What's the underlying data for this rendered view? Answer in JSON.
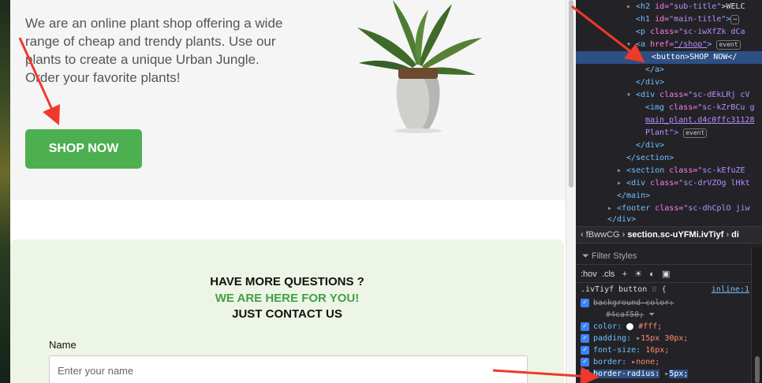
{
  "page": {
    "hero_text": "We are an online plant shop offering a wide range of cheap and trendy plants. Use our plants to create a unique Urban Jungle. Order your favorite plants!",
    "shop_button": "SHOP NOW",
    "contact": {
      "line1": "HAVE MORE QUESTIONS ?",
      "line2": "WE ARE HERE FOR YOU!",
      "line3": "JUST CONTACT US",
      "name_label": "Name",
      "name_placeholder": "Enter your name"
    }
  },
  "devtools": {
    "dom": {
      "l1_tag": "<h2 ",
      "l1_attr": "id=",
      "l1_val": "\"sub-title\"",
      "l1_txt": ">WELC",
      "l2_tag": "<h1 ",
      "l2_attr": "id=",
      "l2_val": "\"main-title\"",
      "l2_txt": ">",
      "l3_tag": "<p ",
      "l3_attr": "class=",
      "l3_val": "\"sc-iwXfZk dCa",
      "l4_tag": "<a ",
      "l4_attr": "href=",
      "l4_val": "\"/shop\"",
      "l4_end": ">",
      "badge_event": "event",
      "l5": "<button>SHOP NOW</",
      "l6": "</a>",
      "l7": "</div>",
      "l8_tag": "<div ",
      "l8_attr": "class=",
      "l8_val": "\"sc-dEkLRj cV",
      "l9_tag": "<img ",
      "l9_attr": "class=",
      "l9_val": "\"sc-kZrBCu g",
      "l10": "main_plant.d4c0ffc31128",
      "l11": "Plant\">",
      "l12": "</div>",
      "l13": "</section>",
      "l14_tag": "<section ",
      "l14_attr": "class=",
      "l14_val": "\"sc-kEfuZE",
      "l15_tag": "<div ",
      "l15_attr": "class=",
      "l15_val": "\"sc-drVZOg lHkt",
      "l16": "</main>",
      "l17_tag": "<footer ",
      "l17_attr": "class=",
      "l17_val": "\"sc-dhCplO jiw",
      "l18": "</div>"
    },
    "breadcrumb": {
      "crumb1": "fBwwCG",
      "crumb2": "section.sc-uYFMi.ivTiyf",
      "crumb3": "di"
    },
    "filter_placeholder": "Filter Styles",
    "tools": {
      "hov": ":hov",
      "cls": ".cls",
      "plus": "+"
    },
    "rule": {
      "selector": ".ivTiyf button",
      "brace": "{",
      "source": "inline:1",
      "p1": "background-color:",
      "v1": "#4caf50;",
      "p2": "color:",
      "v2": "#fff;",
      "p3": "padding:",
      "v3": "15px 30px;",
      "p4": "font-size:",
      "v4": "16px;",
      "p5": "border:",
      "v5": "none;",
      "p6": "border-radius:",
      "v6": "5px;"
    }
  },
  "colors": {
    "accent_green": "#4caf50",
    "contact_bg": "#edf5e6",
    "arrow_red": "#f0392b",
    "devtools_bg": "#232327",
    "selection_blue": "#2d4f84"
  }
}
